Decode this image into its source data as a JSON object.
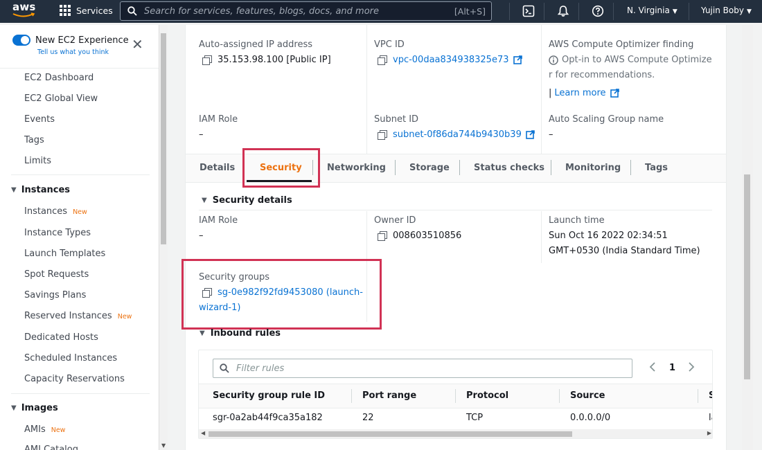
{
  "topnav": {
    "logo_text": "aws",
    "services_label": "Services",
    "search_placeholder": "Search for services, features, blogs, docs, and more",
    "search_shortcut": "[Alt+S]",
    "region": "N. Virginia",
    "user": "Yujin Boby"
  },
  "sidebar": {
    "experience_title": "New EC2 Experience",
    "experience_link": "Tell us what you think",
    "new_badge": "New",
    "items_top": [
      "EC2 Dashboard",
      "EC2 Global View",
      "Events",
      "Tags",
      "Limits"
    ],
    "instances_header": "Instances",
    "instances_items": [
      "Instances",
      "Instance Types",
      "Launch Templates",
      "Spot Requests",
      "Savings Plans",
      "Reserved Instances",
      "Dedicated Hosts",
      "Scheduled Instances",
      "Capacity Reservations"
    ],
    "images_header": "Images",
    "images_items": [
      "AMIs",
      "AMI Catalog"
    ]
  },
  "details": {
    "ip_label": "Auto-assigned IP address",
    "ip_value": "35.153.98.100 [Public IP]",
    "vpc_label": "VPC ID",
    "vpc_value": "vpc-00daa834938325e73",
    "optimizer_label": "AWS Compute Optimizer finding",
    "optimizer_text_1": "Opt-in to AWS Compute Optimize",
    "optimizer_text_2": "r for recommendations.",
    "optimizer_link": "Learn more",
    "iam_label": "IAM Role",
    "iam_value": "–",
    "subnet_label": "Subnet ID",
    "subnet_value": "subnet-0f86da744b9430b39",
    "asg_label": "Auto Scaling Group name",
    "asg_value": "–"
  },
  "tabs": [
    "Details",
    "Security",
    "Networking",
    "Storage",
    "Status checks",
    "Monitoring",
    "Tags"
  ],
  "security": {
    "header": "Security details",
    "iam_label": "IAM Role",
    "iam_value": "–",
    "owner_label": "Owner ID",
    "owner_value": "008603510856",
    "launch_label": "Launch time",
    "launch_value_1": "Sun Oct 16 2022 02:34:51",
    "launch_value_2": "GMT+0530 (India Standard Time)",
    "sg_label": "Security groups",
    "sg_value_1": "sg-0e982f92fd9453080 (launch-",
    "sg_value_2": "wizard-1)"
  },
  "inbound": {
    "header": "Inbound rules",
    "filter_placeholder": "Filter rules",
    "page": "1",
    "columns": [
      "Security group rule ID",
      "Port range",
      "Protocol",
      "Source",
      "S"
    ],
    "rows": [
      [
        "sgr-0a2ab44f9ca35a182",
        "22",
        "TCP",
        "0.0.0.0/0",
        "la"
      ]
    ]
  },
  "colors": {
    "nav_bg": "#232f3e",
    "link": "#0972d3",
    "accent": "#ec7211",
    "highlight": "#d13254"
  }
}
